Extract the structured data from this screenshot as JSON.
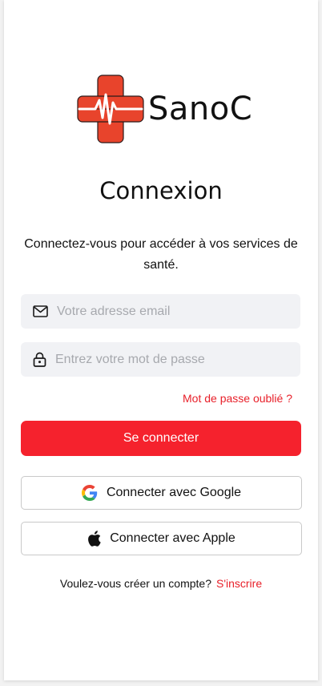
{
  "brand": {
    "name": "SanoC",
    "accent_color": "#f5222d",
    "logo_color": "#e8442c"
  },
  "login": {
    "title": "Connexion",
    "subtitle": "Connectez-vous pour accéder à vos services de santé.",
    "email_placeholder": "Votre adresse email",
    "password_placeholder": "Entrez votre mot de passe",
    "forgot_password": "Mot de passe oublié ?",
    "submit_label": "Se connecter",
    "google_label": "Connecter avec Google",
    "apple_label": "Connecter avec Apple",
    "signup_prompt": "Voulez-vous créer un compte?",
    "signup_link": "S'inscrire"
  },
  "icons": {
    "logo": "medical-cross-heartbeat-icon",
    "email": "envelope-icon",
    "password": "padlock-icon",
    "google": "google-g-icon",
    "apple": "apple-icon"
  }
}
